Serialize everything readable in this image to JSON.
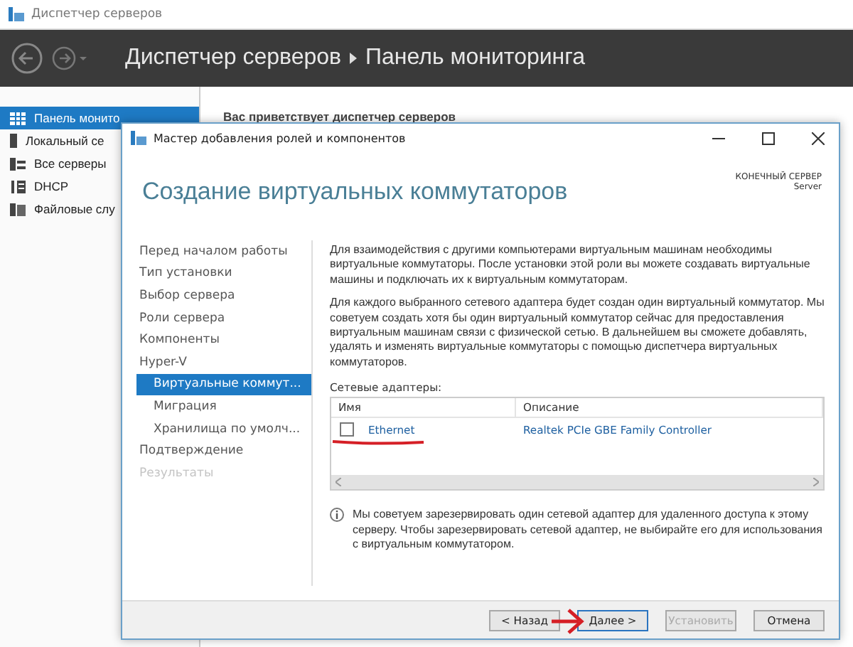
{
  "window": {
    "title": "Диспетчер серверов"
  },
  "header": {
    "breadcrumb": [
      "Диспетчер серверов",
      "Панель мониторинга"
    ]
  },
  "sidebar": {
    "items": [
      {
        "label": "Панель монито",
        "selected": true
      },
      {
        "label": "Локальный се",
        "selected": false
      },
      {
        "label": "Все серверы",
        "selected": false
      },
      {
        "label": "DHCP",
        "selected": false
      },
      {
        "label": "Файловые слу",
        "selected": false
      }
    ]
  },
  "welcome": "Вас приветствует диспетчер серверов",
  "dialog": {
    "title": "Мастер добавления ролей и компонентов",
    "heading": "Создание виртуальных коммутаторов",
    "target_label": "КОНЕЧНЫЙ СЕРВЕР",
    "target_value": "Server",
    "steps": [
      {
        "label": "Перед началом работы",
        "selected": false,
        "disabled": false
      },
      {
        "label": "Тип установки",
        "selected": false,
        "disabled": false
      },
      {
        "label": "Выбор сервера",
        "selected": false,
        "disabled": false
      },
      {
        "label": "Роли сервера",
        "selected": false,
        "disabled": false
      },
      {
        "label": "Компоненты",
        "selected": false,
        "disabled": false
      },
      {
        "label": "Hyper-V",
        "selected": false,
        "disabled": false,
        "children": [
          {
            "label": "Виртуальные коммут...",
            "selected": true,
            "disabled": false
          },
          {
            "label": "Миграция",
            "selected": false,
            "disabled": false
          },
          {
            "label": "Хранилища по умолч...",
            "selected": false,
            "disabled": false
          }
        ]
      },
      {
        "label": "Подтверждение",
        "selected": false,
        "disabled": false
      },
      {
        "label": "Результаты",
        "selected": false,
        "disabled": true
      }
    ],
    "paragraphs": [
      "Для взаимодействия с другими компьютерами виртуальным машинам необходимы виртуальные коммутаторы. После установки этой роли вы можете создавать виртуальные машины и подключать их к виртуальным коммутаторам.",
      "Для каждого выбранного сетевого адаптера будет создан один виртуальный коммутатор. Мы советуем создать хотя бы один виртуальный коммутатор сейчас для предоставления виртуальным машинам связи с физической сетью. В дальнейшем вы сможете добавлять, удалять и изменять виртуальные коммутаторы с помощью диспетчера виртуальных коммутаторов."
    ],
    "adapters_label": "Сетевые адаптеры:",
    "columns": [
      "Имя",
      "Описание"
    ],
    "rows": [
      {
        "name": "Ethernet",
        "description": "Realtek PCIe GBE Family Controller",
        "checked": false
      }
    ],
    "note": "Мы советуем зарезервировать один сетевой адаптер для удаленного доступа к этому серверу. Чтобы зарезервировать сетевой адаптер, не выбирайте его для использования с виртуальным коммутатором.",
    "buttons": [
      {
        "label": "< Назад",
        "disabled": false,
        "primary": false
      },
      {
        "label": "Далее >",
        "disabled": false,
        "primary": true
      },
      {
        "label": "Установить",
        "disabled": true,
        "primary": false
      },
      {
        "label": "Отмена",
        "disabled": false,
        "primary": false
      }
    ]
  }
}
